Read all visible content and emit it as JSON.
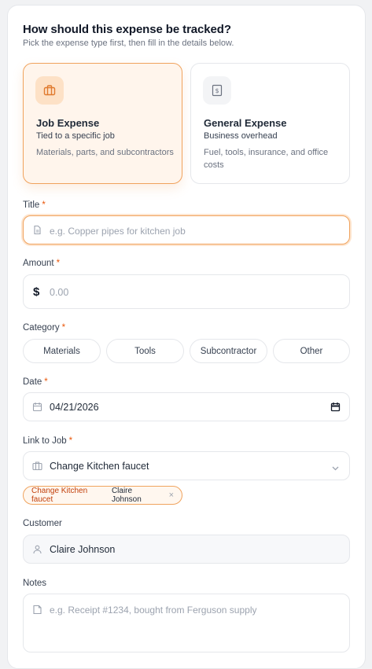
{
  "header": {
    "title": "How should this expense be tracked?",
    "subtitle": "Pick the expense type first, then fill in the details below."
  },
  "types": [
    {
      "name": "Job Expense",
      "subtitle": "Tied to a specific job",
      "description": "Materials, parts, and subcontractors",
      "icon": "briefcase-icon",
      "selected": true
    },
    {
      "name": "General Expense",
      "subtitle": "Business overhead",
      "description": "Fuel, tools, insurance, and office costs",
      "icon": "receipt-icon",
      "selected": false
    }
  ],
  "title_field": {
    "label": "Title",
    "required_mark": "*",
    "placeholder": "e.g. Copper pipes for kitchen job"
  },
  "amount_field": {
    "label": "Amount",
    "required_mark": "*",
    "currency": "$",
    "placeholder": "0.00"
  },
  "category": {
    "label": "Category",
    "required_mark": "*",
    "options": [
      "Materials",
      "Tools",
      "Subcontractor",
      "Other"
    ]
  },
  "date_field": {
    "label": "Date",
    "required_mark": "*",
    "value": "04/21/2026"
  },
  "job_field": {
    "label": "Link to Job",
    "required_mark": "*",
    "value": "Change Kitchen faucet",
    "pill": {
      "job": "Change Kitchen faucet",
      "customer": "Claire Johnson",
      "remove": "×"
    }
  },
  "customer_field": {
    "label": "Customer",
    "value": "Claire Johnson"
  },
  "notes_field": {
    "label": "Notes",
    "placeholder": "e.g. Receipt #1234, bought from Ferguson supply"
  },
  "colors": {
    "accent": "#ea580c",
    "accent_border": "#f0a35e",
    "accent_bg": "#fff5ec"
  }
}
